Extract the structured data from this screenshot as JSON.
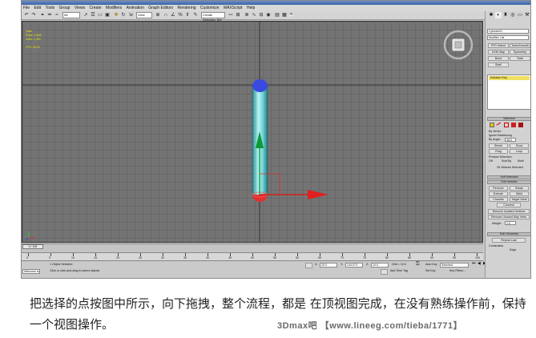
{
  "menu": [
    "File",
    "Edit",
    "Tools",
    "Group",
    "Views",
    "Create",
    "Modifiers",
    "Animation",
    "Graph Editors",
    "Rendering",
    "Customize",
    "MAXScript",
    "Help"
  ],
  "toolbar": {
    "selection_filter": "All",
    "view_dropdown": "View",
    "named_selection": "Create Selection Set",
    "icons": [
      "undo-icon",
      "redo-icon",
      "link-icon",
      "unlink-icon",
      "bind-icon",
      "select-icon",
      "select-by-name-icon",
      "rect-select-icon",
      "window-icon",
      "move-icon",
      "rotate-icon",
      "scale-icon",
      "snap-icon",
      "mirror-icon",
      "align-icon",
      "render-icon",
      "teapot-icon"
    ]
  },
  "viewport": {
    "label": "Perspective",
    "stats": [
      "Total",
      "Polys: 1,348",
      "Verts: 1,300",
      "",
      "FPS: 90.00"
    ]
  },
  "command_panel": {
    "object_name": "Cylinder01",
    "modifier_list": "Modifier List",
    "buttons": [
      "FFD Select",
      "TurboSmooth",
      "UVW Map",
      "Symmetry",
      "Bend",
      "Twist",
      "Shell"
    ],
    "stack_item": "Editable Poly",
    "selection_rollout": "Selection",
    "by_vertex": "By Vertex",
    "ignore_backfacing": "Ignore Backfacing",
    "by_angle": "By Angle:",
    "by_angle_value": "45.0",
    "shrink": "Shrink",
    "grow": "Grow",
    "ring": "Ring",
    "loop": "Loop",
    "preview_selection": "Preview Selection",
    "preview_opts": [
      "Off",
      "SubObj",
      "Multi"
    ],
    "selected_count": "28 Vertices Selected",
    "soft_selection": "Soft Selection",
    "edit_vertices": "Edit Vertices",
    "remove": "Remove",
    "break": "Break",
    "extrude": "Extrude",
    "weld": "Weld",
    "chamfer": "Chamfer",
    "target_weld": "Target Weld",
    "connect": "Connect",
    "remove_isolated": "Remove Isolated Vertices",
    "remove_unused": "Remove Unused Map Verts",
    "weight_label": "Weight:",
    "weight_value": "1.0",
    "edit_geometry": "Edit Geometry",
    "repeat_last": "Repeat Last",
    "constraints": "Constraints",
    "edge": "Edge"
  },
  "timeline": {
    "frame": "0 / 100",
    "ticks": [
      "0",
      "5",
      "10",
      "15",
      "20",
      "25",
      "30",
      "35",
      "40",
      "45",
      "50",
      "55",
      "60",
      "65",
      "70",
      "75",
      "80",
      "85",
      "90",
      "95",
      "100"
    ]
  },
  "status": {
    "welcome": "Welcome to M",
    "selected": "1 Object Selected",
    "prompt": "Click or click-and-drag to select objects",
    "x_label": "X:",
    "x_value": "20.0",
    "y_label": "Y:",
    "y_value": "144.073",
    "z_label": "Z:",
    "z_value": "10.0",
    "grid": "Grid = 10.0",
    "add_time_tag": "Add Time Tag",
    "auto_key": "Auto Key",
    "auto_key_mode": "Selected",
    "set_key": "Set Key",
    "key_filters": "Key Filters..."
  },
  "caption": "把选择的点按图中所示，向下拖拽，整个流程，都是 在顶视图完成，在没有熟练操作前，保持一个视图操作。",
  "watermark": "3Dmax吧 【www.lineeg.com/tieba/1771】"
}
